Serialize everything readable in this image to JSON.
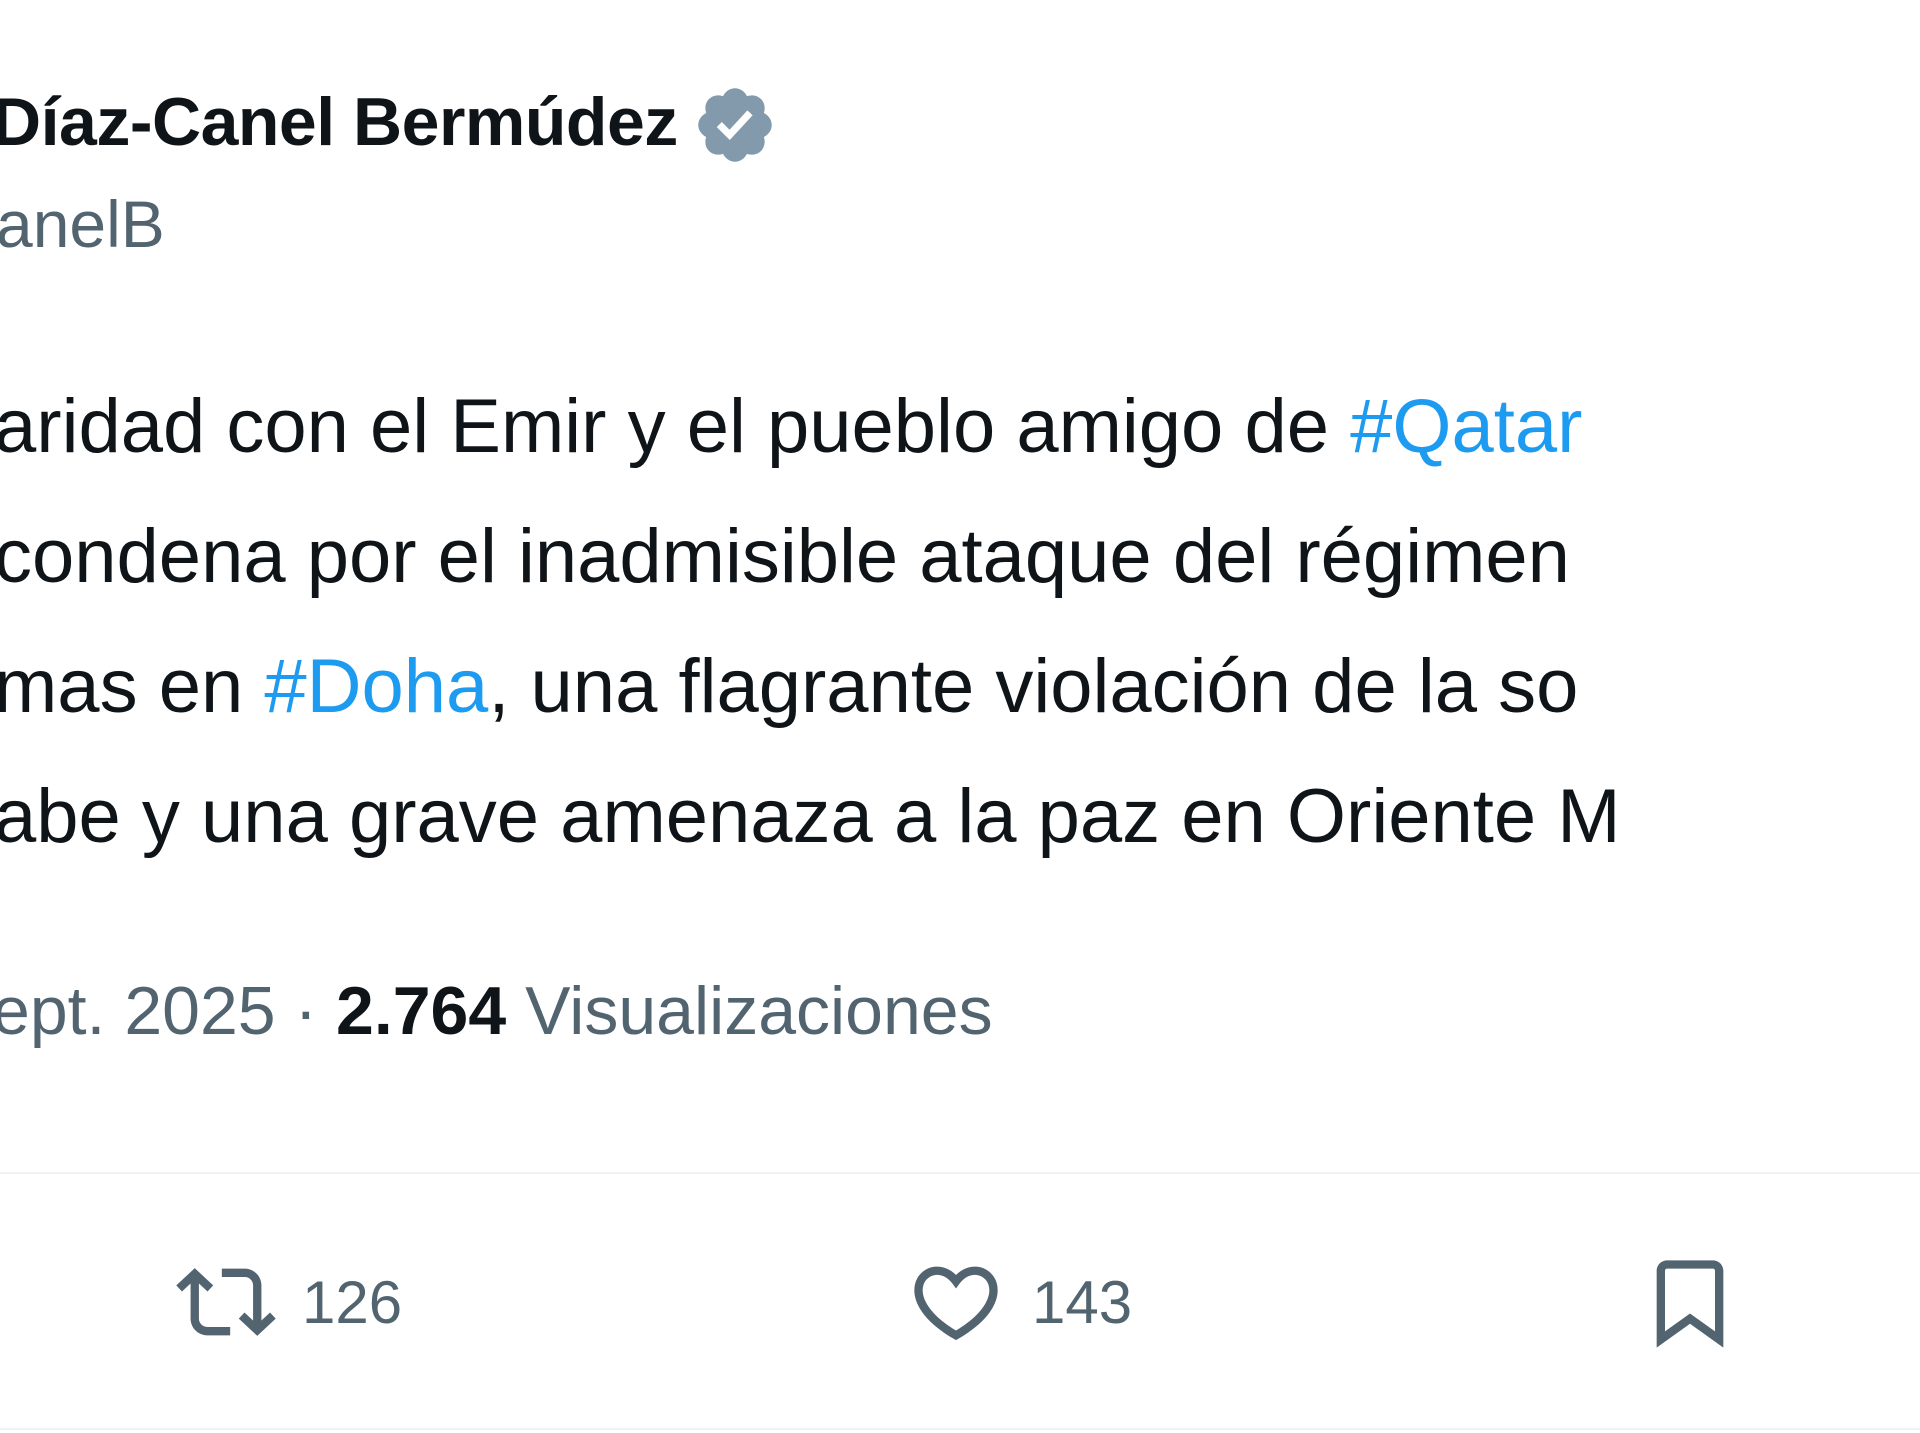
{
  "author": {
    "name": "Díaz-Canel Bermúdez",
    "handle": "anelB",
    "verified_icon": "verified-badge-icon",
    "verified_color": "#829aab"
  },
  "tweet": {
    "lines": [
      {
        "before": "aridad con el Emir y el pueblo amigo de ",
        "hashtag": "#Qatar",
        "after": ""
      },
      {
        "before": " condena por el inadmisible ataque del régimen",
        "hashtag": "",
        "after": ""
      },
      {
        "before": "mas en ",
        "hashtag": "#Doha",
        "after": ", una flagrante violación de la so"
      },
      {
        "before": "abe y una grave amenaza a la paz en Oriente M",
        "hashtag": "",
        "after": ""
      }
    ],
    "hashtag_color": "#1d9bf0"
  },
  "meta": {
    "date": "ept. 2025",
    "separator": " · ",
    "views_count": "2.764",
    "views_label": "Visualizaciones"
  },
  "actions": {
    "repost": {
      "icon": "repost-icon",
      "count": "126"
    },
    "like": {
      "icon": "heart-icon",
      "count": "143"
    },
    "bookmark": {
      "icon": "bookmark-icon"
    }
  },
  "colors": {
    "text": "#0f1419",
    "secondary": "#536471",
    "divider": "#eff3f4"
  }
}
